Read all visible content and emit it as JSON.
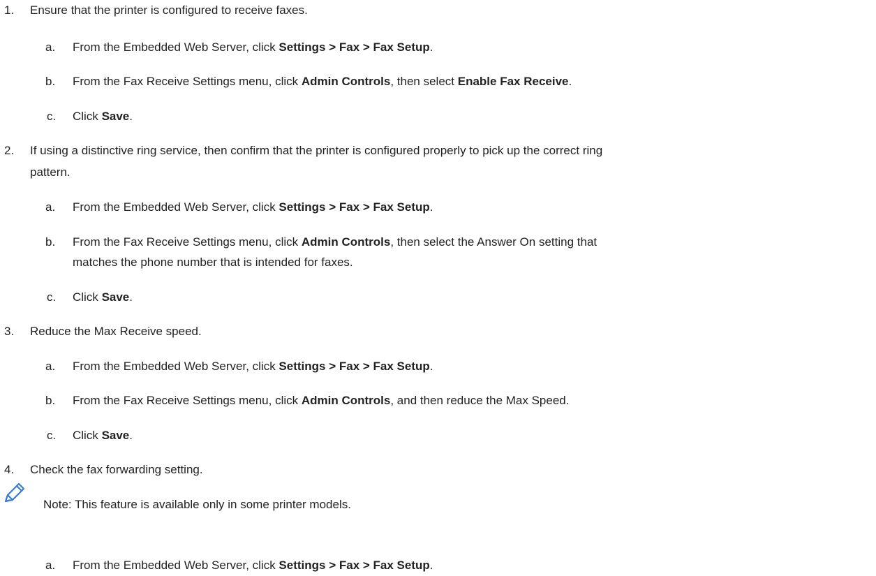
{
  "steps": [
    {
      "number": "1.",
      "text": "Ensure that the printer is configured to receive faxes.",
      "substeps": [
        {
          "letter": "a.",
          "pre": "From the Embedded Web Server, click ",
          "b1": "Settings > Fax > Fax Setup",
          "post": "."
        },
        {
          "letter": "b.",
          "pre": "From the Fax Receive Settings menu, click ",
          "b1": "Admin Controls",
          "mid": ", then select ",
          "b2": "Enable Fax Receive",
          "post": "."
        },
        {
          "letter": "c.",
          "pre": "Click ",
          "b1": "Save",
          "post": "."
        }
      ]
    },
    {
      "number": "2.",
      "text_line1": "If using a distinctive ring service, then confirm that the printer is configured properly to pick up the correct ring",
      "text_line2": "pattern.",
      "substeps": [
        {
          "letter": "a.",
          "pre": "From the Embedded Web Server, click ",
          "b1": "Settings > Fax > Fax Setup",
          "post": "."
        },
        {
          "letter": "b.",
          "pre": "From the Fax Receive Settings menu, click ",
          "b1": "Admin Controls",
          "post": ", then select the Answer On setting that",
          "line2": "matches the phone number that is intended for faxes."
        },
        {
          "letter": "c.",
          "pre": "Click ",
          "b1": "Save",
          "post": "."
        }
      ]
    },
    {
      "number": "3.",
      "text": "Reduce the Max Receive speed.",
      "substeps": [
        {
          "letter": "a.",
          "pre": "From the Embedded Web Server, click ",
          "b1": "Settings > Fax > Fax Setup",
          "post": "."
        },
        {
          "letter": "b.",
          "pre": "From the Fax Receive Settings menu, click ",
          "b1": "Admin Controls",
          "post": ", and then reduce the Max Speed."
        },
        {
          "letter": "c.",
          "pre": "Click ",
          "b1": "Save",
          "post": "."
        }
      ]
    },
    {
      "number": "4.",
      "text": "Check the fax forwarding setting.",
      "note": "Note: This feature is available only in some printer models.",
      "substeps": [
        {
          "letter": "a.",
          "pre": "From the Embedded Web Server, click ",
          "b1": "Settings > Fax > Fax Setup",
          "post": "."
        }
      ]
    }
  ],
  "note_icon": "pencil-icon",
  "colors": {
    "text": "#222222",
    "icon": "#3a7bd5"
  }
}
